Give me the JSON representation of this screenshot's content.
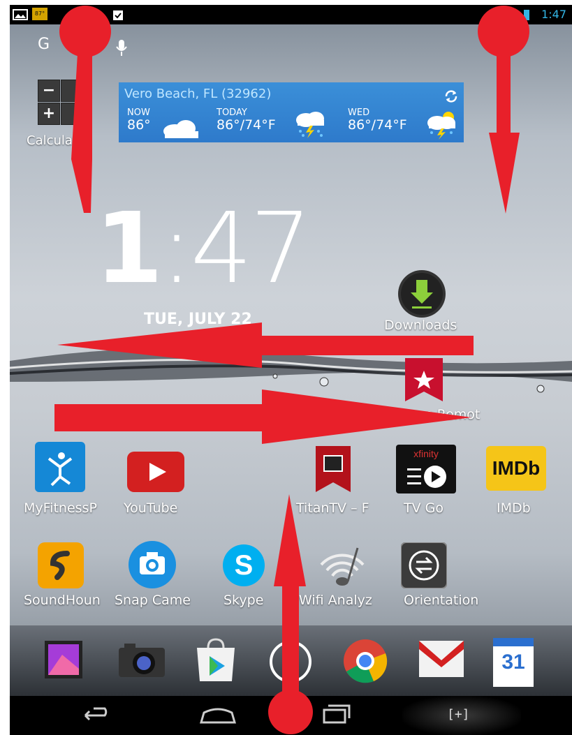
{
  "status_bar": {
    "time": "1:47",
    "icons": [
      "picture-icon",
      "temperature-icon",
      "clipboard-icon",
      "battery-icon"
    ],
    "temp_badge": "87°"
  },
  "search": {
    "google_label": "G",
    "icons": [
      "mic-icon"
    ]
  },
  "calculator": {
    "label": "Calculator",
    "keys": [
      "−",
      "+"
    ]
  },
  "weather": {
    "location": "Vero Beach, FL (32962)",
    "now_label": "NOW",
    "now_temp": "86°",
    "today_label": "TODAY",
    "today_temp": "86°/74°F",
    "wed_label": "WED",
    "wed_temp": "86°/74°F",
    "icons": [
      "refresh-icon",
      "cloud-icon",
      "storm-icon",
      "storm-sun-icon"
    ]
  },
  "clock": {
    "hour": "1",
    "minutes": ":47",
    "date": "TUE, JULY 22"
  },
  "desktop_apps": [
    {
      "label": "Downloads",
      "icon": "download-icon"
    },
    {
      "label": "Remote",
      "icon": "ribbon-star-icon",
      "visible_text": "e Remot"
    }
  ],
  "app_row_1": [
    {
      "label": "MyFitnessP",
      "icon": "myfitnesspal-icon"
    },
    {
      "label": "YouTube",
      "icon": "youtube-icon"
    },
    {
      "label": "TitanTV – F",
      "icon": "titantv-icon"
    },
    {
      "label": "TV Go",
      "icon": "xfinity-icon",
      "badge": "xfinity"
    },
    {
      "label": "IMDb",
      "icon": "imdb-icon",
      "badge": "IMDb"
    }
  ],
  "app_row_2": [
    {
      "label": "SoundHoun",
      "icon": "soundhound-icon"
    },
    {
      "label": "Snap Came",
      "icon": "camera-icon"
    },
    {
      "label": "Skype",
      "icon": "skype-icon"
    },
    {
      "label": "Wifi Analyz",
      "icon": "wifi-icon"
    },
    {
      "label": "Orientation",
      "icon": "orientation-icon"
    }
  ],
  "dock": [
    {
      "name": "gallery",
      "icon": "gallery-icon"
    },
    {
      "name": "camera",
      "icon": "camera-icon"
    },
    {
      "name": "play-store",
      "icon": "play-store-icon"
    },
    {
      "name": "app-drawer",
      "icon": "app-drawer-icon"
    },
    {
      "name": "chrome",
      "icon": "chrome-icon"
    },
    {
      "name": "gmail",
      "icon": "gmail-icon"
    },
    {
      "name": "calendar",
      "icon": "calendar-icon",
      "badge": "31"
    }
  ],
  "navigation": [
    "back-icon",
    "home-icon",
    "recents-icon",
    "screenshot-icon"
  ],
  "navigation_text": {
    "screenshot": "[+]"
  },
  "overlay": {
    "color": "#e8202a",
    "arrows": [
      "arrow-down-left",
      "arrow-down-right",
      "arrow-left",
      "arrow-right",
      "arrow-up"
    ]
  }
}
